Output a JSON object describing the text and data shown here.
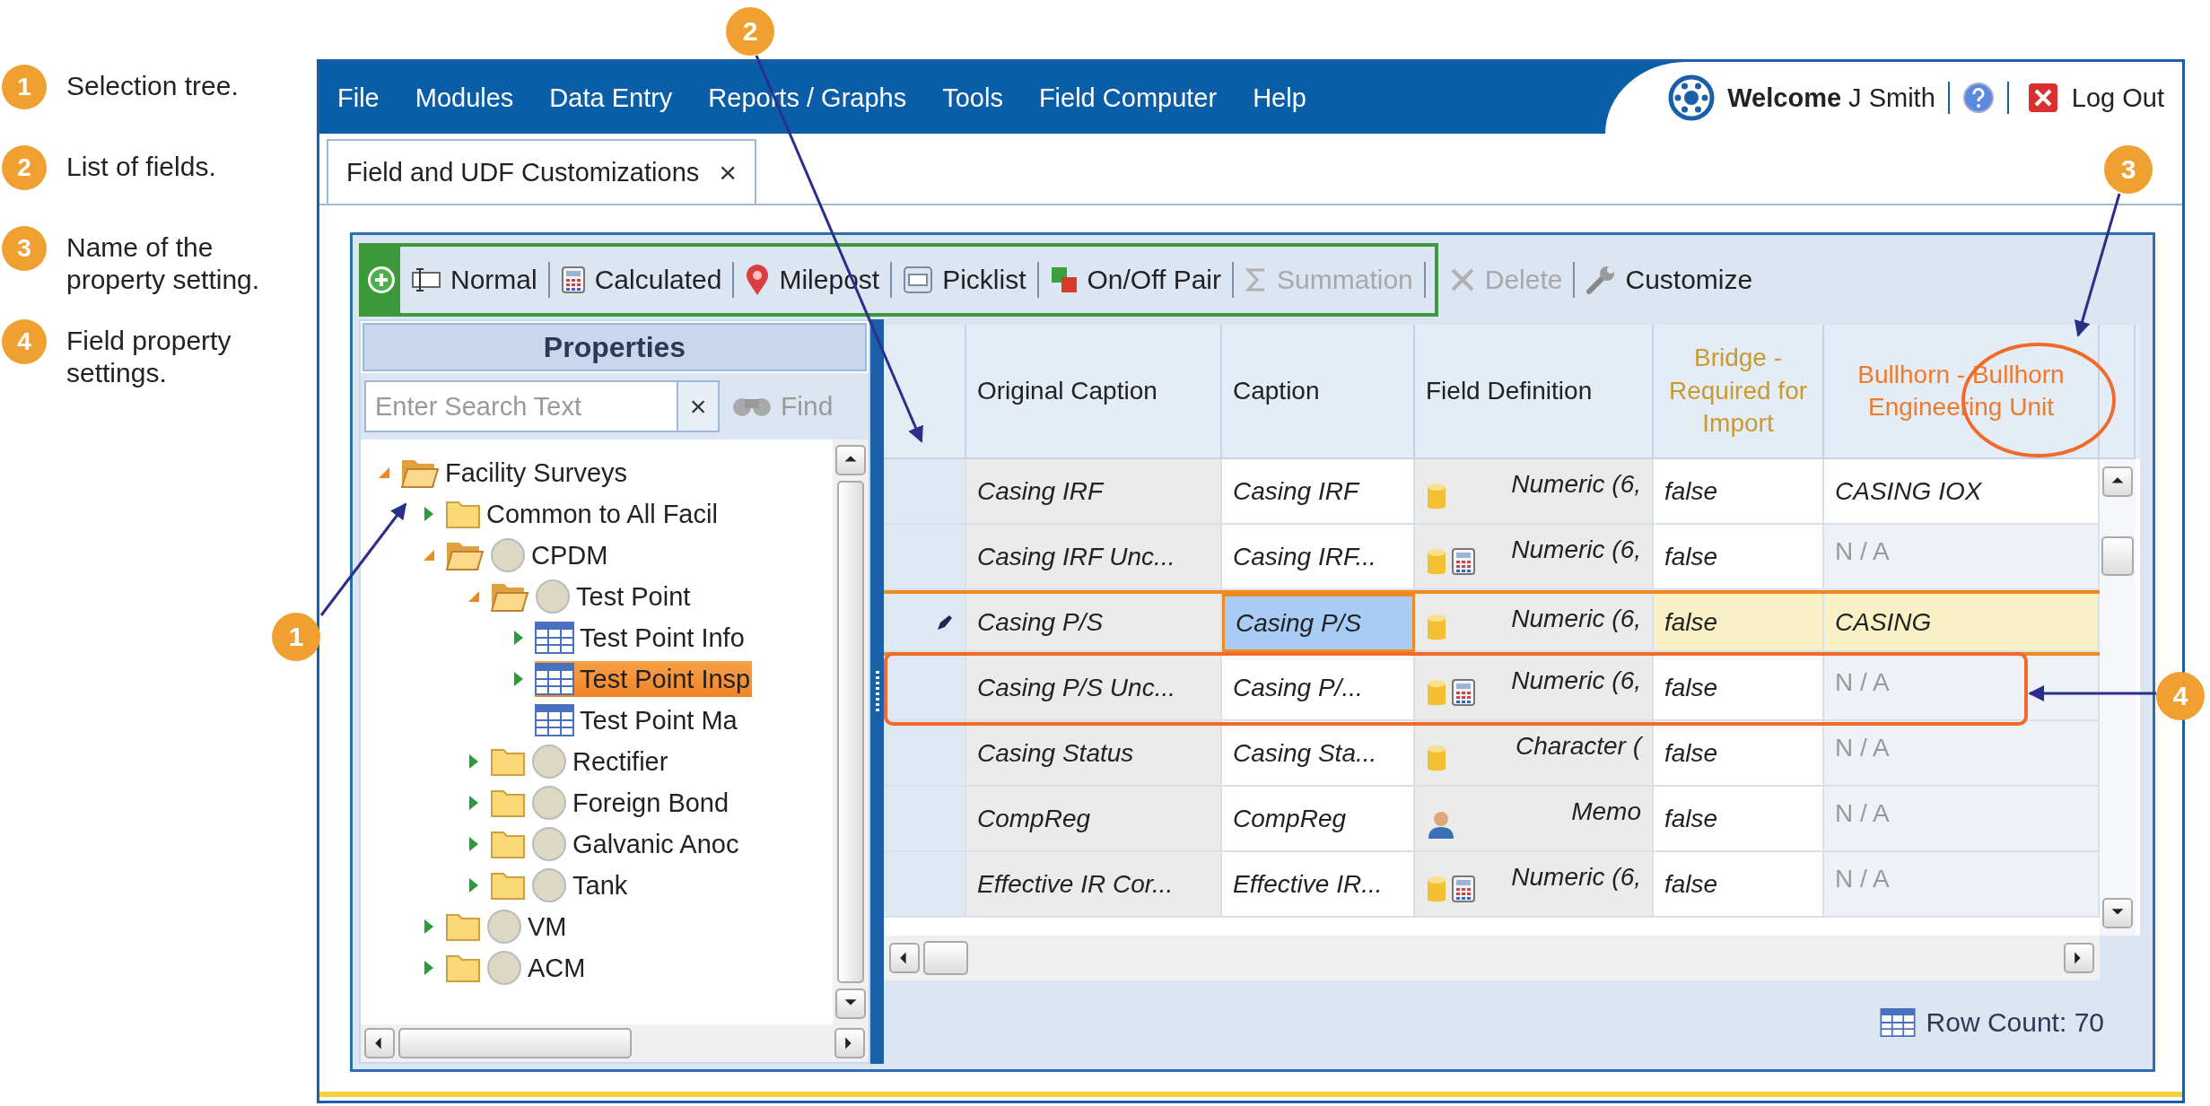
{
  "legend": [
    {
      "number": "1",
      "text": "Selection tree."
    },
    {
      "number": "2",
      "text": "List of fields."
    },
    {
      "number": "3",
      "text": "Name of the property setting."
    },
    {
      "number": "4",
      "text": "Field property settings."
    }
  ],
  "callouts": [
    {
      "number": "1"
    },
    {
      "number": "2"
    },
    {
      "number": "3"
    },
    {
      "number": "4"
    }
  ],
  "menu": [
    "File",
    "Modules",
    "Data Entry",
    "Reports / Graphs",
    "Tools",
    "Field Computer",
    "Help"
  ],
  "user": {
    "welcome": "**Welcome** J Smith",
    "logout": "Log Out"
  },
  "tabs": [
    {
      "label": "Field and UDF Customizations",
      "selected": true,
      "close": "×"
    }
  ],
  "toolbar": {
    "group": [
      {
        "kind": "add"
      },
      {
        "kind": "normal",
        "label": "Normal",
        "disabled": false
      },
      {
        "kind": "calculated",
        "label": "Calculated",
        "disabled": false
      },
      {
        "kind": "milepost",
        "label": "Milepost",
        "disabled": false
      },
      {
        "kind": "picklist",
        "label": "Picklist",
        "disabled": false
      },
      {
        "kind": "onoff",
        "label": "On/Off Pair",
        "disabled": false
      },
      {
        "kind": "summation",
        "label": "Summation",
        "disabled": true
      }
    ],
    "items": [
      {
        "kind": "delete",
        "label": "Delete",
        "disabled": true
      },
      {
        "kind": "customize",
        "label": "Customize",
        "disabled": false
      }
    ]
  },
  "properties": {
    "title": "Properties",
    "search": {
      "placeholder": "Enter Search Text",
      "clear": "×"
    },
    "find": {
      "label": "Find",
      "disabled": true
    },
    "tree": [
      {
        "label": "Facility Surveys",
        "kind": "folder",
        "circle": false,
        "expandable": true,
        "expanded": true,
        "selected": false,
        "children": [
          {
            "label": "Common to All Facil",
            "kind": "folder",
            "circle": false,
            "expandable": true,
            "expanded": false,
            "selected": false
          },
          {
            "label": "CPDM",
            "kind": "folder",
            "circle": true,
            "expandable": true,
            "expanded": true,
            "selected": false,
            "children": [
              {
                "label": "Test Point",
                "kind": "folder",
                "circle": true,
                "expandable": true,
                "expanded": true,
                "selected": false,
                "children": [
                  {
                    "label": "Test Point Info",
                    "kind": "table",
                    "circle": false,
                    "expandable": true,
                    "expanded": false,
                    "selected": false
                  },
                  {
                    "label": "Test Point Insp",
                    "kind": "table",
                    "circle": false,
                    "expandable": true,
                    "expanded": false,
                    "selected": true
                  },
                  {
                    "label": "Test Point Ma",
                    "kind": "table",
                    "circle": false,
                    "expandable": false,
                    "selected": false
                  }
                ]
              },
              {
                "label": "Rectifier",
                "kind": "folder",
                "circle": true,
                "expandable": true,
                "expanded": false,
                "selected": false
              },
              {
                "label": "Foreign Bond",
                "kind": "folder",
                "circle": true,
                "expandable": true,
                "expanded": false,
                "selected": false
              },
              {
                "label": "Galvanic Anoc",
                "kind": "folder",
                "circle": true,
                "expandable": true,
                "expanded": false,
                "selected": false
              },
              {
                "label": "Tank",
                "kind": "folder",
                "circle": true,
                "expandable": true,
                "expanded": false,
                "selected": false
              }
            ]
          },
          {
            "label": "VM",
            "kind": "folder",
            "circle": true,
            "expandable": true,
            "expanded": false,
            "selected": false
          },
          {
            "label": "ACM",
            "kind": "folder",
            "circle": true,
            "expandable": true,
            "expanded": false,
            "selected": false
          }
        ]
      }
    ]
  },
  "grid": {
    "columns": [
      {
        "label": "Original Caption",
        "color": "#222222"
      },
      {
        "label": "Caption",
        "color": "#222222"
      },
      {
        "label": "Field Definition",
        "color": "#222222"
      },
      {
        "label": "Bridge - Required for Import",
        "color": "#c99a2e"
      },
      {
        "label": "Bullhorn - Bullhorn Engineering Unit",
        "color": "#f07a2a"
      }
    ],
    "rows": [
      {
        "original": "Casing IRF",
        "caption": "Casing IRF",
        "icons": [
          {
            "kind": "database"
          }
        ],
        "definition": "Numeric (6,",
        "bridge": "false",
        "bullhorn": "CASING IOX",
        "bullhorn_na": false,
        "editing": false,
        "caption_selected": false
      },
      {
        "original": "Casing IRF Unc...",
        "caption": "Casing IRF...",
        "icons": [
          {
            "kind": "database"
          },
          {
            "kind": "calculator"
          }
        ],
        "definition": "Numeric (6,",
        "bridge": "false",
        "bullhorn": "N / A",
        "bullhorn_na": true,
        "editing": false,
        "caption_selected": false
      },
      {
        "original": "Casing P/S",
        "caption": "Casing P/S",
        "icons": [
          {
            "kind": "database"
          }
        ],
        "definition": "Numeric (6,",
        "bridge": "false",
        "bullhorn": "CASING",
        "bullhorn_na": false,
        "editing": true,
        "caption_selected": true
      },
      {
        "original": "Casing P/S Unc...",
        "caption": "Casing P/...",
        "icons": [
          {
            "kind": "database"
          },
          {
            "kind": "calculator"
          }
        ],
        "definition": "Numeric (6,",
        "bridge": "false",
        "bullhorn": "N / A",
        "bullhorn_na": true,
        "editing": false,
        "caption_selected": false
      },
      {
        "original": "Casing Status",
        "caption": "Casing Sta...",
        "icons": [
          {
            "kind": "database"
          }
        ],
        "definition": "Character (",
        "bridge": "false",
        "bullhorn": "N / A",
        "bullhorn_na": true,
        "editing": false,
        "caption_selected": false
      },
      {
        "original": "CompReg",
        "caption": "CompReg",
        "icons": [
          {
            "kind": "person"
          }
        ],
        "definition": "Memo",
        "bridge": "false",
        "bullhorn": "N / A",
        "bullhorn_na": true,
        "editing": false,
        "caption_selected": false
      },
      {
        "original": "Effective IR Cor...",
        "caption": "Effective IR...",
        "icons": [
          {
            "kind": "database"
          },
          {
            "kind": "calculator"
          }
        ],
        "definition": "Numeric (6,",
        "bridge": "false",
        "bullhorn": "N / A",
        "bullhorn_na": true,
        "editing": false,
        "caption_selected": false
      }
    ],
    "row_count": {
      "label": "Row Count:",
      "value": "70"
    }
  }
}
